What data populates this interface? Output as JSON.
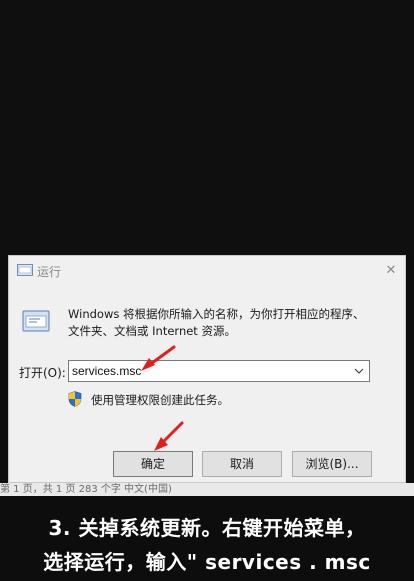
{
  "dialog": {
    "title": "运行",
    "description_line1": "Windows 将根据你所输入的名称，为你打开相应的程序、",
    "description_line2": "文件夹、文档或 Internet 资源。",
    "open_label": "打开(O):",
    "open_value": "services.msc",
    "admin_text": "使用管理权限创建此任务。",
    "buttons": {
      "ok": "确定",
      "cancel": "取消",
      "browse": "浏览(B)..."
    },
    "close_glyph": "✕"
  },
  "statusbar": {
    "text": "第 1 页，共 1 页    283 个字    中文(中国)"
  },
  "caption": {
    "line1": "3. 关掉系统更新。右键开始菜单，",
    "line2": "选择运行，输入\" services . msc"
  },
  "colors": {
    "arrow": "#e0201a",
    "shield_blue": "#2d6fd1",
    "shield_yellow": "#f3c623"
  }
}
